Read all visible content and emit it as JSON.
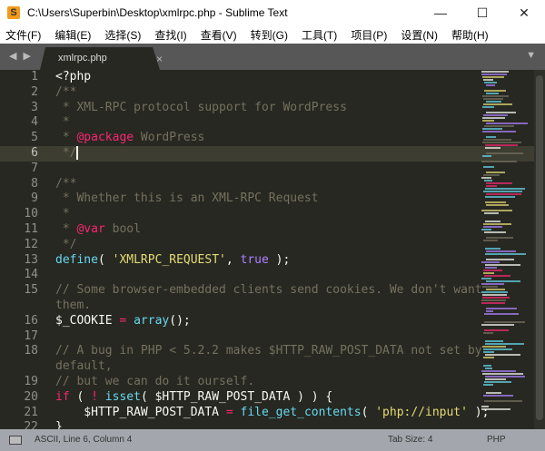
{
  "window": {
    "title": "C:\\Users\\Superbin\\Desktop\\xmlrpc.php - Sublime Text",
    "app_icon": "S",
    "minimize": "—",
    "maximize": "☐",
    "close": "✕"
  },
  "menu": [
    "文件(F)",
    "编辑(E)",
    "选择(S)",
    "查找(I)",
    "查看(V)",
    "转到(G)",
    "工具(T)",
    "项目(P)",
    "设置(N)",
    "帮助(H)"
  ],
  "tabs": {
    "nav": "◀ ▶",
    "active": "xmlrpc.php",
    "close": "×",
    "menu": "▼"
  },
  "editor": {
    "current_line": 6,
    "rows": [
      {
        "n": "1",
        "t": [
          [
            "t",
            "<?php"
          ]
        ]
      },
      {
        "n": "2",
        "t": [
          [
            "c",
            "/**"
          ]
        ]
      },
      {
        "n": "3",
        "t": [
          [
            "c",
            " * XML-RPC protocol support for WordPress"
          ]
        ]
      },
      {
        "n": "4",
        "t": [
          [
            "c",
            " *"
          ]
        ]
      },
      {
        "n": "5",
        "t": [
          [
            "c",
            " * "
          ],
          [
            "k",
            "@package"
          ],
          [
            "c",
            " WordPress"
          ]
        ]
      },
      {
        "n": "6",
        "t": [
          [
            "c",
            " */"
          ]
        ],
        "caret": true
      },
      {
        "n": "7",
        "t": []
      },
      {
        "n": "8",
        "t": [
          [
            "c",
            "/**"
          ]
        ]
      },
      {
        "n": "9",
        "t": [
          [
            "c",
            " * Whether this is an XML-RPC Request"
          ]
        ]
      },
      {
        "n": "10",
        "t": [
          [
            "c",
            " *"
          ]
        ]
      },
      {
        "n": "11",
        "t": [
          [
            "c",
            " * "
          ],
          [
            "k",
            "@var"
          ],
          [
            "c",
            " bool"
          ]
        ]
      },
      {
        "n": "12",
        "t": [
          [
            "c",
            " */"
          ]
        ]
      },
      {
        "n": "13",
        "t": [
          [
            "f",
            "define"
          ],
          [
            "t",
            "( "
          ],
          [
            "s",
            "'XMLRPC_REQUEST'"
          ],
          [
            "t",
            ", "
          ],
          [
            "p",
            "true"
          ],
          [
            "t",
            " );"
          ]
        ]
      },
      {
        "n": "14",
        "t": []
      },
      {
        "n": "15",
        "t": [
          [
            "c",
            "// Some browser-embedded clients send cookies. We don't want"
          ]
        ]
      },
      {
        "n": "",
        "t": [
          [
            "c",
            "them."
          ]
        ]
      },
      {
        "n": "16",
        "t": [
          [
            "t",
            "$_COOKIE "
          ],
          [
            "k",
            "="
          ],
          [
            "t",
            " "
          ],
          [
            "f",
            "array"
          ],
          [
            "t",
            "();"
          ]
        ]
      },
      {
        "n": "17",
        "t": []
      },
      {
        "n": "18",
        "t": [
          [
            "c",
            "// A bug in PHP < 5.2.2 makes $HTTP_RAW_POST_DATA not set by"
          ]
        ]
      },
      {
        "n": "",
        "t": [
          [
            "c",
            "default,"
          ]
        ]
      },
      {
        "n": "19",
        "t": [
          [
            "c",
            "// but we can do it ourself."
          ]
        ]
      },
      {
        "n": "20",
        "t": [
          [
            "k",
            "if"
          ],
          [
            "t",
            " ( "
          ],
          [
            "k",
            "!"
          ],
          [
            "t",
            " "
          ],
          [
            "f",
            "isset"
          ],
          [
            "t",
            "( $HTTP_RAW_POST_DATA ) ) {"
          ]
        ]
      },
      {
        "n": "21",
        "t": [
          [
            "t",
            "    $HTTP_RAW_POST_DATA "
          ],
          [
            "k",
            "="
          ],
          [
            "t",
            " "
          ],
          [
            "f",
            "file_get_contents"
          ],
          [
            "t",
            "( "
          ],
          [
            "s",
            "'php://input'"
          ],
          [
            "t",
            " );"
          ]
        ]
      },
      {
        "n": "22",
        "t": [
          [
            "t",
            "}"
          ]
        ]
      }
    ]
  },
  "status": {
    "position": "ASCII, Line 6, Column 4",
    "tab_size": "Tab Size: 4",
    "syntax": "PHP"
  },
  "colors": {
    "background": "#272822",
    "comment": "#75715e",
    "keyword": "#f92672",
    "function": "#66d9ef",
    "string": "#e6db74",
    "constant": "#ae81ff"
  }
}
